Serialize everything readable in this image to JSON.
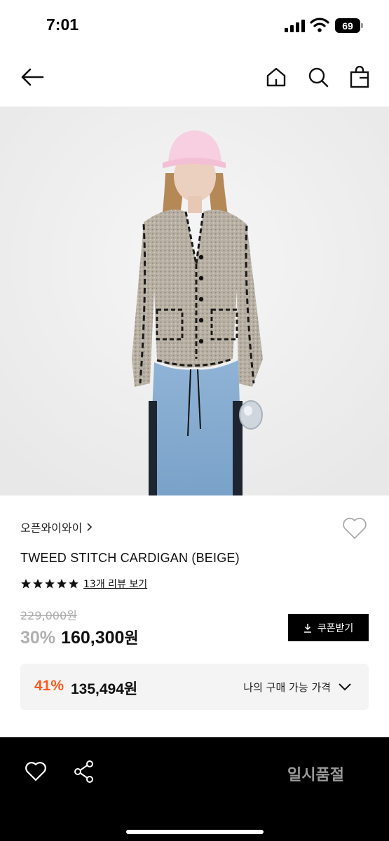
{
  "status": {
    "time": "7:01",
    "battery": "69"
  },
  "product": {
    "brand": "오픈와이와이",
    "name": "TWEED STITCH CARDIGAN (BEIGE)",
    "rating_stars": 5,
    "review_link": "13개 리뷰 보기",
    "original_price": "229,000원",
    "discount": "30%",
    "sale_price": "160,300",
    "sale_price_unit": "원",
    "coupon_label": "쿠폰받기"
  },
  "my_price": {
    "discount": "41%",
    "price": "135,494원",
    "label": "나의 구매 가능 가격"
  },
  "bottom": {
    "soldout_label": "일시품절"
  },
  "colors": {
    "accent_orange": "#ff5a1f",
    "muted_gray": "#b0b0b0",
    "bar_black": "#000000"
  },
  "icons": [
    "back-arrow-icon",
    "home-icon",
    "search-icon",
    "shopping-bag-icon",
    "heart-icon",
    "share-icon",
    "download-icon",
    "chevron-down-icon",
    "star-icon"
  ]
}
